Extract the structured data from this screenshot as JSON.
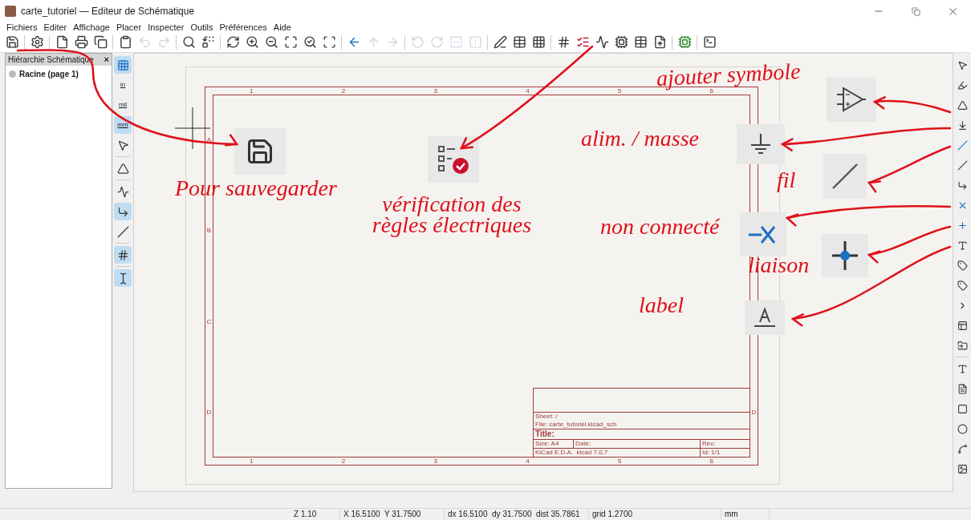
{
  "window": {
    "title": "carte_tutoriel — Editeur de Schématique"
  },
  "menu": [
    "Fichiers",
    "Editer",
    "Affichage",
    "Placer",
    "Inspecter",
    "Outils",
    "Préférences",
    "Aide"
  ],
  "main_toolbar": [
    {
      "kind": "save",
      "disabled": false
    },
    {
      "kind": "separator"
    },
    {
      "kind": "setup",
      "disabled": false
    },
    {
      "kind": "separator"
    },
    {
      "kind": "new-page",
      "disabled": false
    },
    {
      "kind": "print",
      "disabled": false
    },
    {
      "kind": "plot",
      "disabled": false
    },
    {
      "kind": "separator"
    },
    {
      "kind": "paste",
      "disabled": false
    },
    {
      "kind": "undo",
      "disabled": true
    },
    {
      "kind": "redo",
      "disabled": true
    },
    {
      "kind": "separator"
    },
    {
      "kind": "find",
      "disabled": false
    },
    {
      "kind": "replace",
      "disabled": false
    },
    {
      "kind": "separator"
    },
    {
      "kind": "refresh",
      "disabled": false
    },
    {
      "kind": "zoom-in",
      "disabled": false
    },
    {
      "kind": "zoom-out",
      "disabled": false
    },
    {
      "kind": "zoom-fit",
      "disabled": false
    },
    {
      "kind": "zoom-objects",
      "disabled": false
    },
    {
      "kind": "zoom-area",
      "disabled": false
    },
    {
      "kind": "separator"
    },
    {
      "kind": "back",
      "disabled": false
    },
    {
      "kind": "up",
      "disabled": true
    },
    {
      "kind": "forward",
      "disabled": true
    },
    {
      "kind": "separator"
    },
    {
      "kind": "rotate-ccw",
      "disabled": true
    },
    {
      "kind": "rotate-cw",
      "disabled": true
    },
    {
      "kind": "mirror-v",
      "disabled": true
    },
    {
      "kind": "mirror-h",
      "disabled": true
    },
    {
      "kind": "separator"
    },
    {
      "kind": "annotate",
      "disabled": false
    },
    {
      "kind": "symbol-fields",
      "disabled": false
    },
    {
      "kind": "edit-symbols",
      "disabled": false
    },
    {
      "kind": "separator"
    },
    {
      "kind": "netlist",
      "disabled": false
    },
    {
      "kind": "erc",
      "disabled": false
    },
    {
      "kind": "simulator",
      "disabled": false
    },
    {
      "kind": "footprints",
      "disabled": false
    },
    {
      "kind": "bom-table",
      "disabled": false
    },
    {
      "kind": "bom-export",
      "disabled": false
    },
    {
      "kind": "separator"
    },
    {
      "kind": "pcb",
      "disabled": false
    },
    {
      "kind": "separator"
    },
    {
      "kind": "terminal",
      "disabled": false
    }
  ],
  "hierarchy_panel": {
    "title": "Hiérarchie Schématique",
    "close": "×",
    "items": [
      {
        "label": "Racine (page 1)"
      }
    ]
  },
  "left_toolbar": [
    {
      "kind": "grid",
      "on": true
    },
    {
      "kind": "unit",
      "label": "in",
      "on": false
    },
    {
      "kind": "unit",
      "label": "mil",
      "on": false
    },
    {
      "kind": "unit",
      "label": "mm",
      "on": true
    },
    {
      "kind": "cursor",
      "on": false
    },
    {
      "kind": "separator"
    },
    {
      "kind": "pins",
      "on": false
    },
    {
      "kind": "separator"
    },
    {
      "kind": "angle-free",
      "on": false
    },
    {
      "kind": "angle-90",
      "on": true
    },
    {
      "kind": "angle-45",
      "on": false
    },
    {
      "kind": "separator"
    },
    {
      "kind": "netlist",
      "on": true
    },
    {
      "kind": "separator"
    },
    {
      "kind": "properties",
      "on": true
    }
  ],
  "right_toolbar": [
    {
      "kind": "select"
    },
    {
      "kind": "highlight"
    },
    {
      "kind": "symbol"
    },
    {
      "kind": "power"
    },
    {
      "kind": "wire"
    },
    {
      "kind": "bus"
    },
    {
      "kind": "bus-entry"
    },
    {
      "kind": "no-connect"
    },
    {
      "kind": "junction"
    },
    {
      "kind": "label"
    },
    {
      "kind": "net-class"
    },
    {
      "kind": "global-label"
    },
    {
      "kind": "hier-label"
    },
    {
      "kind": "sheet"
    },
    {
      "kind": "sheet-pin"
    },
    {
      "kind": "separator"
    },
    {
      "kind": "text"
    },
    {
      "kind": "textbox"
    },
    {
      "kind": "rectangle"
    },
    {
      "kind": "circle"
    },
    {
      "kind": "arc"
    },
    {
      "kind": "image"
    }
  ],
  "sheet": {
    "top_columns": [
      "1",
      "2",
      "3",
      "4",
      "5",
      "6"
    ],
    "left_rows": [
      "A",
      "B",
      "C",
      "D"
    ],
    "right_rows": [
      "D"
    ],
    "bottom_columns": [
      "1",
      "2",
      "3",
      "4",
      "5",
      "6"
    ],
    "title_block": {
      "sheet": "Sheet: /",
      "file": "File: carte_tutoriel.kicad_sch",
      "title": "Title:",
      "size": "Size: A4",
      "date": "Date:",
      "rev": "Rev:",
      "generator": "KiCad E.D.A.  kicad 7.0.7",
      "id": "Id: 1/1"
    }
  },
  "annotations": [
    {
      "text": "Pour sauvegarder"
    },
    {
      "text": "vérification des règles électriques"
    },
    {
      "text": "ajouter symbole"
    },
    {
      "text": "alim. / masse"
    },
    {
      "text": "fil"
    },
    {
      "text": "non connecté"
    },
    {
      "text": "liaison"
    },
    {
      "text": "label"
    }
  ],
  "status_bar": [
    "Z 1.10",
    "X 16.5100  Y 31.7500",
    "dx 16.5100  dy 31.7500  dist 35.7861",
    "grid 1.2700",
    "mm"
  ]
}
